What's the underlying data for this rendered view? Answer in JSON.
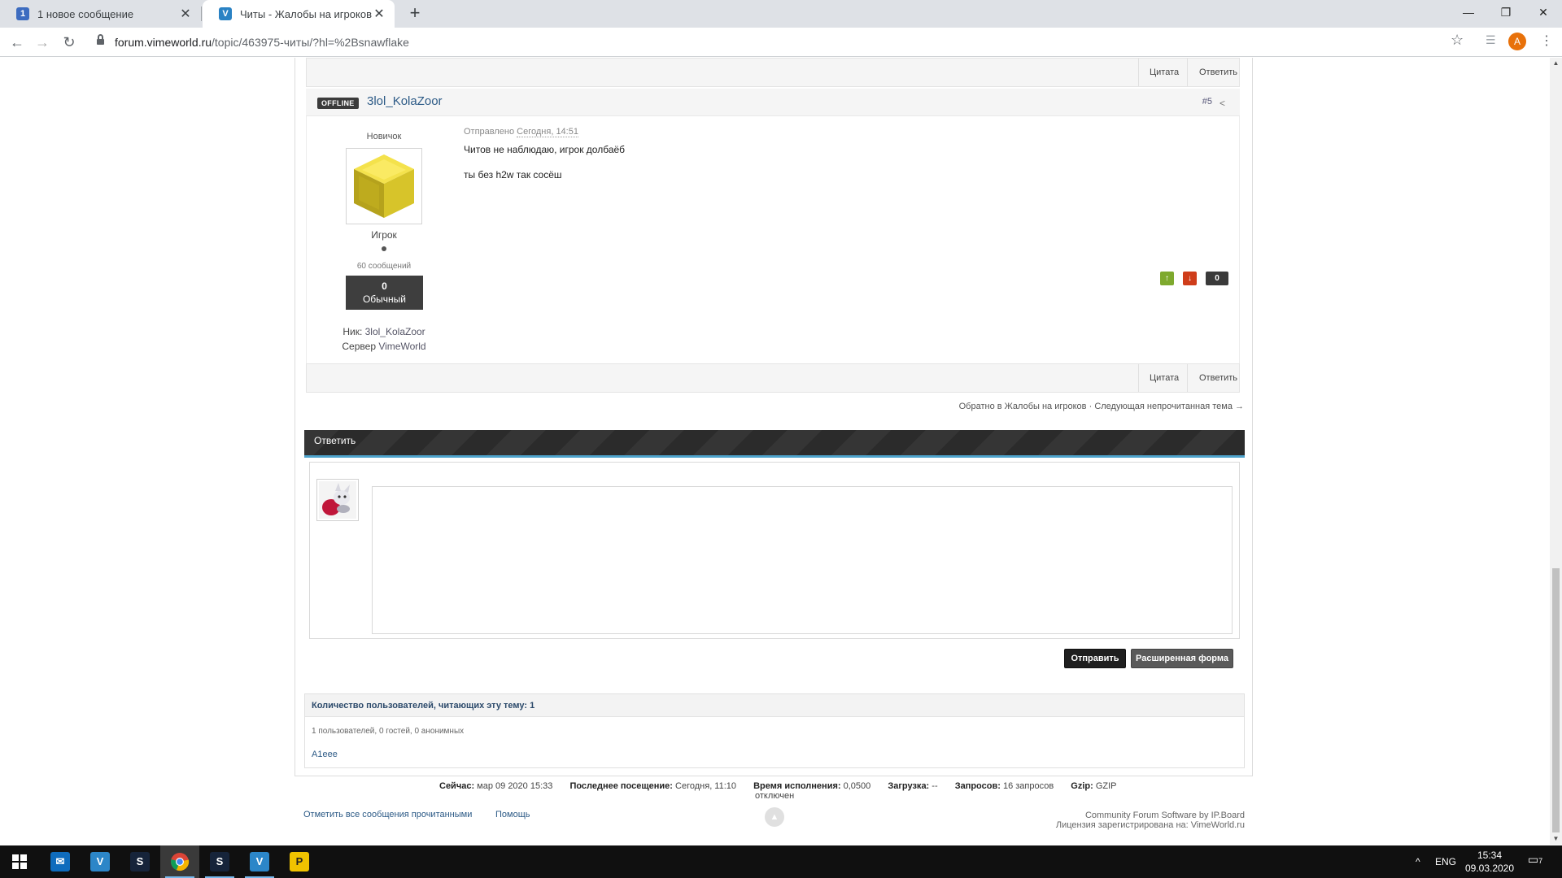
{
  "browser": {
    "tabs": [
      {
        "favicon": "1",
        "title": "1 новое сообщение",
        "active": false
      },
      {
        "favicon": "V",
        "title": "Читы - Жалобы на игроков - Vi",
        "active": true
      }
    ],
    "url_host": "forum.vimeworld.ru",
    "url_path": "/topic/463975-читы/?hl=%2Bsnawflake",
    "profile_initial": "A",
    "icons": [
      "back-icon",
      "forward-icon",
      "reload-icon",
      "lock-icon",
      "star-icon",
      "extension-icon",
      "menu-icon"
    ]
  },
  "postbar": {
    "quote": "Цитата",
    "reply": "Ответить"
  },
  "post": {
    "status": "OFFLINE",
    "author": "3lol_KolaZoor",
    "number": "#5",
    "rank_title": "Новичок",
    "group": "Игрок",
    "posts_count": "60 сообщений",
    "reputation_value": "0",
    "reputation_label": "Обычный",
    "nick_label": "Ник:",
    "nick_value": "3lol_KolaZoor",
    "server_label": "Сервер",
    "server_value": "VimeWorld",
    "posted_label": "Отправлено",
    "posted_date": "Сегодня, 14:51",
    "text_lines": [
      "Читов не наблюдаю, игрок долбаёб",
      "ты без h2w так сосёш"
    ],
    "rep_score": "0"
  },
  "topic_nav": {
    "back": "Обратно в Жалобы на игроков",
    "sep": "·",
    "next": "Следующая непрочитанная тема →"
  },
  "reply": {
    "header": "Ответить",
    "send": "Отправить",
    "full_form": "Расширенная форма"
  },
  "readers": {
    "header": "Количество пользователей, читающих эту тему: 1",
    "sub": "1 пользователей, 0 гостей, 0 анонимных",
    "user": "A1eee"
  },
  "stats": {
    "now_label": "Сейчас:",
    "now_value": "мар 09 2020 15:33",
    "last_label": "Последнее посещение:",
    "last_value": "Сегодня, 11:10",
    "exec_label": "Время исполнения:",
    "exec_value": "0,0500",
    "load_label": "Загрузка:",
    "load_value": "--",
    "req_label": "Запросов:",
    "req_value": "16 запросов",
    "gzip_label": "Gzip:",
    "gzip_value": "GZIP",
    "disabled": "отключен"
  },
  "footer": {
    "mark_read": "Отметить все сообщения прочитанными",
    "help": "Помощь",
    "credits1": "Community Forum Software by IP.Board",
    "credits2": "Лицензия зарегистрирована на: VimeWorld.ru"
  },
  "taskbar": {
    "lang": "ENG",
    "time": "15:34",
    "date": "09.03.2020",
    "notif_count": "7",
    "apps": [
      "windows-start-icon",
      "mail-icon",
      "vimeworld-icon",
      "steam-icon",
      "chrome-icon",
      "steam-icon",
      "vimeworld-icon",
      "launcher-icon"
    ]
  }
}
